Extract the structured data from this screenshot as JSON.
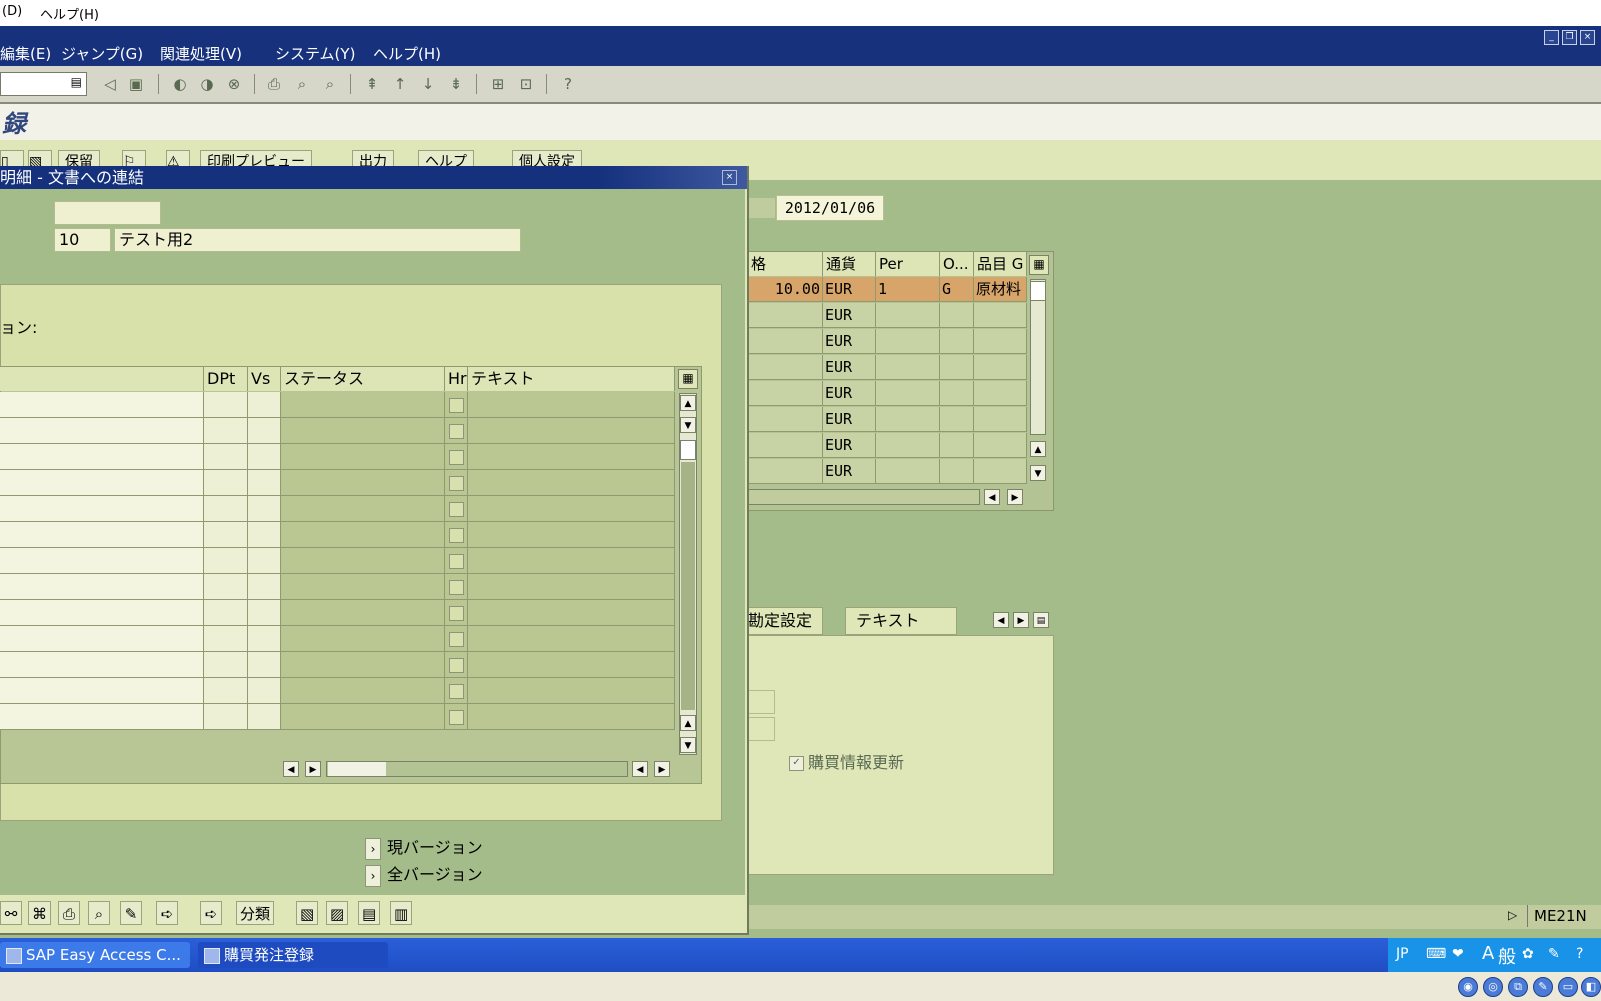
{
  "top_menu": {
    "item_d": "(D)",
    "item_help": "ヘルプ(H)"
  },
  "menubar": {
    "items": [
      "編集(E)",
      "ジャンプ(G)",
      "関連処理(V)",
      "システム(Y)",
      "ヘルプ(H)"
    ]
  },
  "page_title": "録",
  "app_toolbar": {
    "hold": "保留",
    "print_preview": "印刷プレビュー",
    "output": "出力",
    "help": "ヘルプ",
    "personal_settings": "個人設定"
  },
  "header": {
    "doc_date": "2012/01/06"
  },
  "item_table": {
    "columns": [
      "格",
      "通貨",
      "Per",
      "O...",
      "品目 G"
    ],
    "rows": [
      {
        "price": "10.00",
        "currency": "EUR",
        "per": "1",
        "o": "G",
        "group": "原材料"
      },
      {
        "price": "",
        "currency": "EUR",
        "per": "",
        "o": "",
        "group": ""
      },
      {
        "price": "",
        "currency": "EUR",
        "per": "",
        "o": "",
        "group": ""
      },
      {
        "price": "",
        "currency": "EUR",
        "per": "",
        "o": "",
        "group": ""
      },
      {
        "price": "",
        "currency": "EUR",
        "per": "",
        "o": "",
        "group": ""
      },
      {
        "price": "",
        "currency": "EUR",
        "per": "",
        "o": "",
        "group": ""
      },
      {
        "price": "",
        "currency": "EUR",
        "per": "",
        "o": "",
        "group": ""
      },
      {
        "price": "",
        "currency": "EUR",
        "per": "",
        "o": "",
        "group": ""
      }
    ]
  },
  "detail_tabs": [
    "勘定設定",
    "テキスト"
  ],
  "detail_panel": {
    "info_update_label": "購買情報更新",
    "info_update_checked": true
  },
  "status": {
    "transaction": "ME21N"
  },
  "popup": {
    "title": "明細 - 文書への連結",
    "item_no": "10",
    "item_text": "テスト用2",
    "section_label": "ョン:",
    "doc_table": {
      "columns": [
        "DPt",
        "Vs",
        "ステータス",
        "Hr",
        "テキスト"
      ],
      "row_count": 13
    },
    "current_version": "現バージョン",
    "all_versions": "全バージョン",
    "classify": "分類"
  },
  "taskbar": {
    "task1": "SAP Easy Access C...",
    "task2": "購買発注登録",
    "lang": "JP",
    "ime_a": "A",
    "ime_mode": "般"
  },
  "colors": {
    "sap_blue": "#17317d",
    "panel_green": "#a3bc8a",
    "field_bg": "#eef0cf",
    "selected_row": "#d7a56a",
    "taskbar_blue": "#2a5fd9"
  }
}
